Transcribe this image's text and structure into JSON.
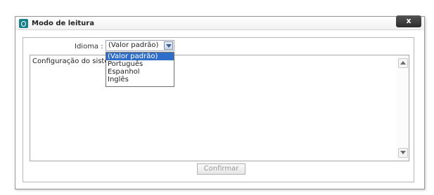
{
  "dialog": {
    "title": "Modo de leitura",
    "close_label": "x",
    "language_label": "Idioma :",
    "language_selected": "(Valor padrão)",
    "language_options": [
      "(Valor padrão)",
      "Português",
      "Espanhol",
      "Inglês"
    ],
    "text_content": "Configuração do siste",
    "confirm_label": "Confirmar"
  },
  "colors": {
    "accent": "#17818a",
    "selection": "#2f6ec8",
    "close_button": "#333333"
  }
}
